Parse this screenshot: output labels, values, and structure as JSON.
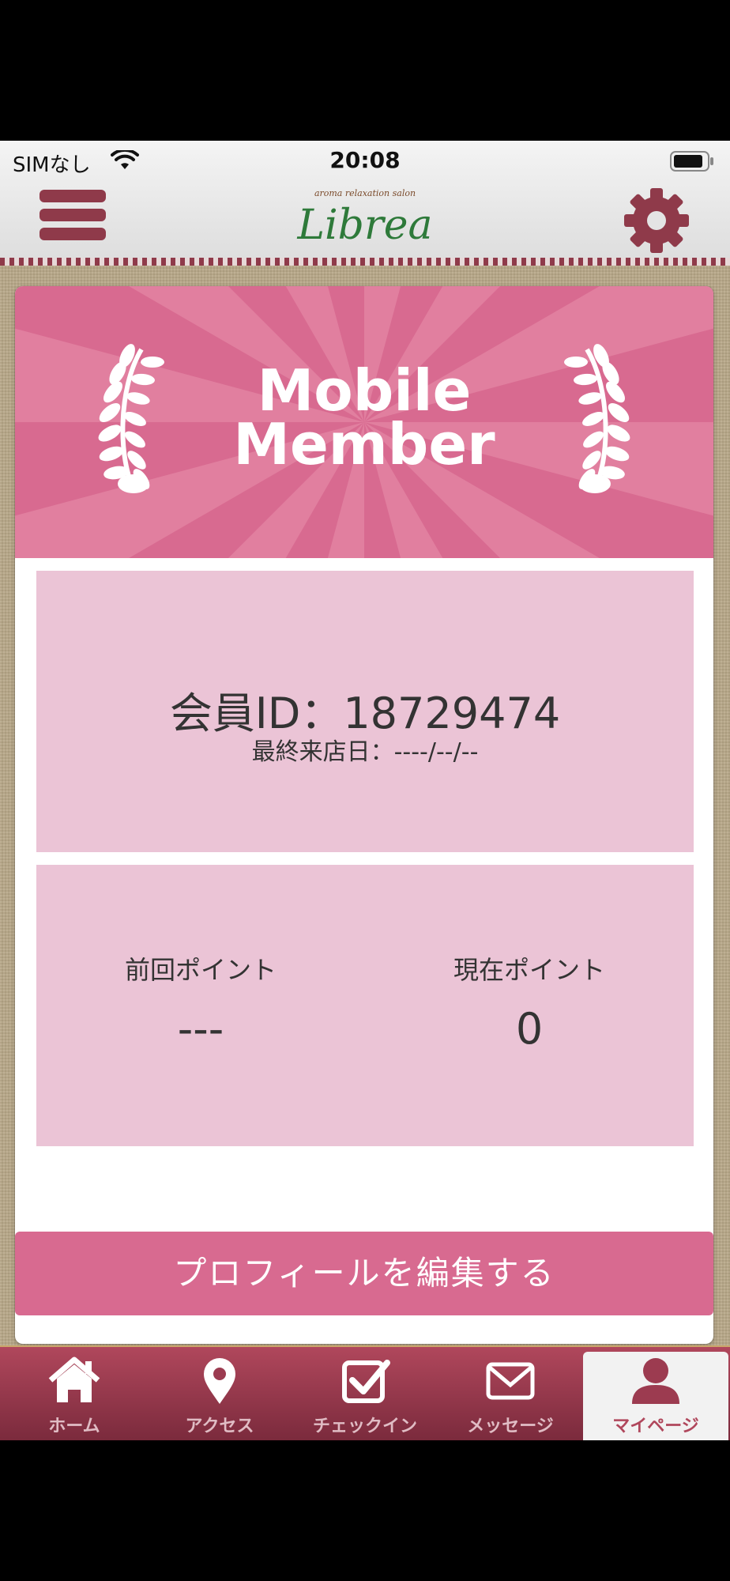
{
  "status_bar": {
    "carrier": "SIMなし",
    "time": "20:08"
  },
  "header": {
    "logo_tagline": "aroma relaxation salon",
    "logo_name": "Librea",
    "menu_icon": "hamburger-icon",
    "settings_icon": "gear-icon"
  },
  "card": {
    "banner_line1": "Mobile",
    "banner_line2": "Member",
    "member_id": "会員ID：18729474",
    "last_visit": "最終来店日：----/--/--",
    "previous_points_label": "前回ポイント",
    "previous_points_value": "---",
    "current_points_label": "現在ポイント",
    "current_points_value": "0"
  },
  "edit_profile_button": "プロフィールを編集する",
  "tabs": [
    {
      "label": "ホーム",
      "icon": "home-icon"
    },
    {
      "label": "アクセス",
      "icon": "map-pin-icon"
    },
    {
      "label": "チェックイン",
      "icon": "checkbox-icon"
    },
    {
      "label": "メッセージ",
      "icon": "envelope-icon"
    },
    {
      "label": "マイページ",
      "icon": "user-icon",
      "active": true
    }
  ],
  "colors": {
    "accent": "#d86a90",
    "panel": "#ebc4d6",
    "brand_dark": "#8f3a4a",
    "logo_green": "#2e7a3a"
  }
}
